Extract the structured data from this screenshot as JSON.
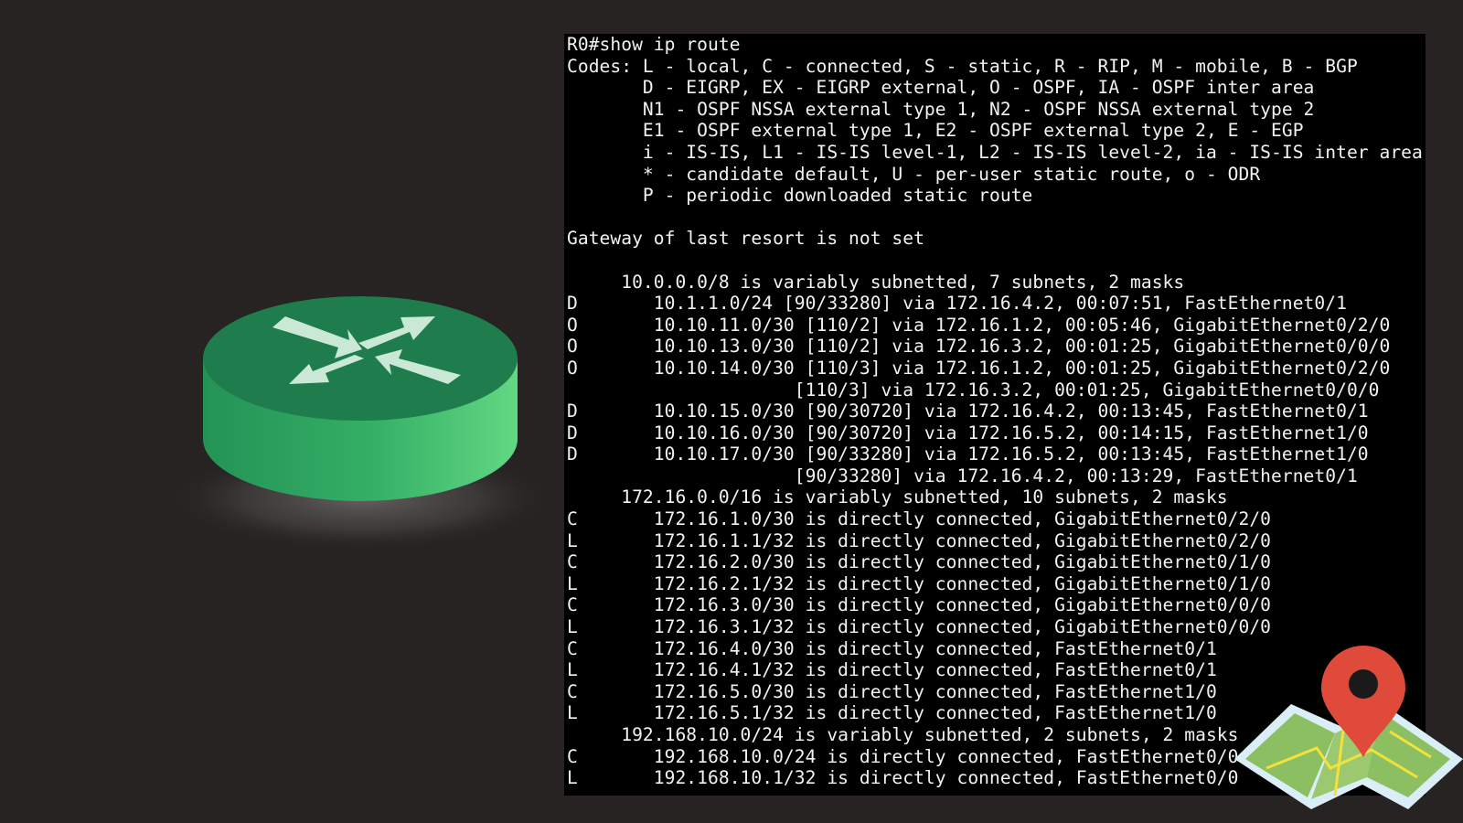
{
  "router_icon": {
    "name": "router-icon",
    "colors": {
      "top": "#1e7b4c",
      "side_left": "#2a9a5c",
      "side_right": "#5fd67d",
      "arrows": "#c9e8d6"
    }
  },
  "map_icon": {
    "name": "map-pin-icon",
    "colors": {
      "pin": "#e04a3a",
      "map_green": "#8cbf62",
      "map_border": "#d9eef7",
      "road": "#f3e23a"
    }
  },
  "terminal": {
    "background": "#000000",
    "text_color": "#f2f2f2",
    "lines": [
      "R0#show ip route",
      "Codes: L - local, C - connected, S - static, R - RIP, M - mobile, B - BGP",
      "       D - EIGRP, EX - EIGRP external, O - OSPF, IA - OSPF inter area",
      "       N1 - OSPF NSSA external type 1, N2 - OSPF NSSA external type 2",
      "       E1 - OSPF external type 1, E2 - OSPF external type 2, E - EGP",
      "       i - IS-IS, L1 - IS-IS level-1, L2 - IS-IS level-2, ia - IS-IS inter area",
      "       * - candidate default, U - per-user static route, o - ODR",
      "       P - periodic downloaded static route",
      "",
      "Gateway of last resort is not set",
      "",
      "     10.0.0.0/8 is variably subnetted, 7 subnets, 2 masks",
      "D       10.1.1.0/24 [90/33280] via 172.16.4.2, 00:07:51, FastEthernet0/1",
      "O       10.10.11.0/30 [110/2] via 172.16.1.2, 00:05:46, GigabitEthernet0/2/0",
      "O       10.10.13.0/30 [110/2] via 172.16.3.2, 00:01:25, GigabitEthernet0/0/0",
      "O       10.10.14.0/30 [110/3] via 172.16.1.2, 00:01:25, GigabitEthernet0/2/0",
      "                     [110/3] via 172.16.3.2, 00:01:25, GigabitEthernet0/0/0",
      "D       10.10.15.0/30 [90/30720] via 172.16.4.2, 00:13:45, FastEthernet0/1",
      "D       10.10.16.0/30 [90/30720] via 172.16.5.2, 00:14:15, FastEthernet1/0",
      "D       10.10.17.0/30 [90/33280] via 172.16.5.2, 00:13:45, FastEthernet1/0",
      "                     [90/33280] via 172.16.4.2, 00:13:29, FastEthernet0/1",
      "     172.16.0.0/16 is variably subnetted, 10 subnets, 2 masks",
      "C       172.16.1.0/30 is directly connected, GigabitEthernet0/2/0",
      "L       172.16.1.1/32 is directly connected, GigabitEthernet0/2/0",
      "C       172.16.2.0/30 is directly connected, GigabitEthernet0/1/0",
      "L       172.16.2.1/32 is directly connected, GigabitEthernet0/1/0",
      "C       172.16.3.0/30 is directly connected, GigabitEthernet0/0/0",
      "L       172.16.3.1/32 is directly connected, GigabitEthernet0/0/0",
      "C       172.16.4.0/30 is directly connected, FastEthernet0/1",
      "L       172.16.4.1/32 is directly connected, FastEthernet0/1",
      "C       172.16.5.0/30 is directly connected, FastEthernet1/0",
      "L       172.16.5.1/32 is directly connected, FastEthernet1/0",
      "     192.168.10.0/24 is variably subnetted, 2 subnets, 2 masks",
      "C       192.168.10.0/24 is directly connected, FastEthernet0/0",
      "L       192.168.10.1/32 is directly connected, FastEthernet0/0"
    ]
  }
}
